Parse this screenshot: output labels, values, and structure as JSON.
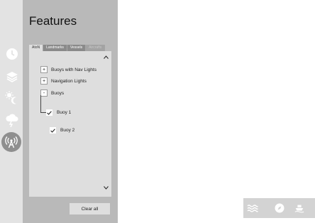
{
  "panel": {
    "title": "Features",
    "tabs": [
      {
        "label": "AtoN",
        "state": "active"
      },
      {
        "label": "Landmarks",
        "state": "normal"
      },
      {
        "label": "Vessels",
        "state": "normal"
      },
      {
        "label": "Aircrafts",
        "state": "disabled"
      }
    ],
    "items": [
      {
        "label": "Buoys with Nav Lights",
        "control": "+"
      },
      {
        "label": "Navigation Lights",
        "control": "+"
      },
      {
        "label": "Buoys",
        "control": "-"
      },
      {
        "label": "Buoy 1",
        "control": "check"
      },
      {
        "label": "Buoy 2",
        "control": "check"
      }
    ],
    "scroll_up_icon": "chevron-up-icon",
    "scroll_down_icon": "chevron-down-icon",
    "clear_button": "Clear all"
  },
  "rail": {
    "icons": [
      "clock-icon",
      "layers-icon",
      "day-night-icon",
      "weather-icon",
      "signal-tower-icon"
    ],
    "active_icon": "signal-tower-icon"
  },
  "toolbar": {
    "icons": [
      "waves-icon",
      "compass-icon",
      "ship-icon"
    ]
  },
  "colors": {
    "panel_bg": "#b9b9b9",
    "list_bg": "#dedede",
    "rail_bg": "#e3e3e3",
    "active_tab_bg": "#dedede",
    "tab_bg": "#8a8a8a"
  }
}
